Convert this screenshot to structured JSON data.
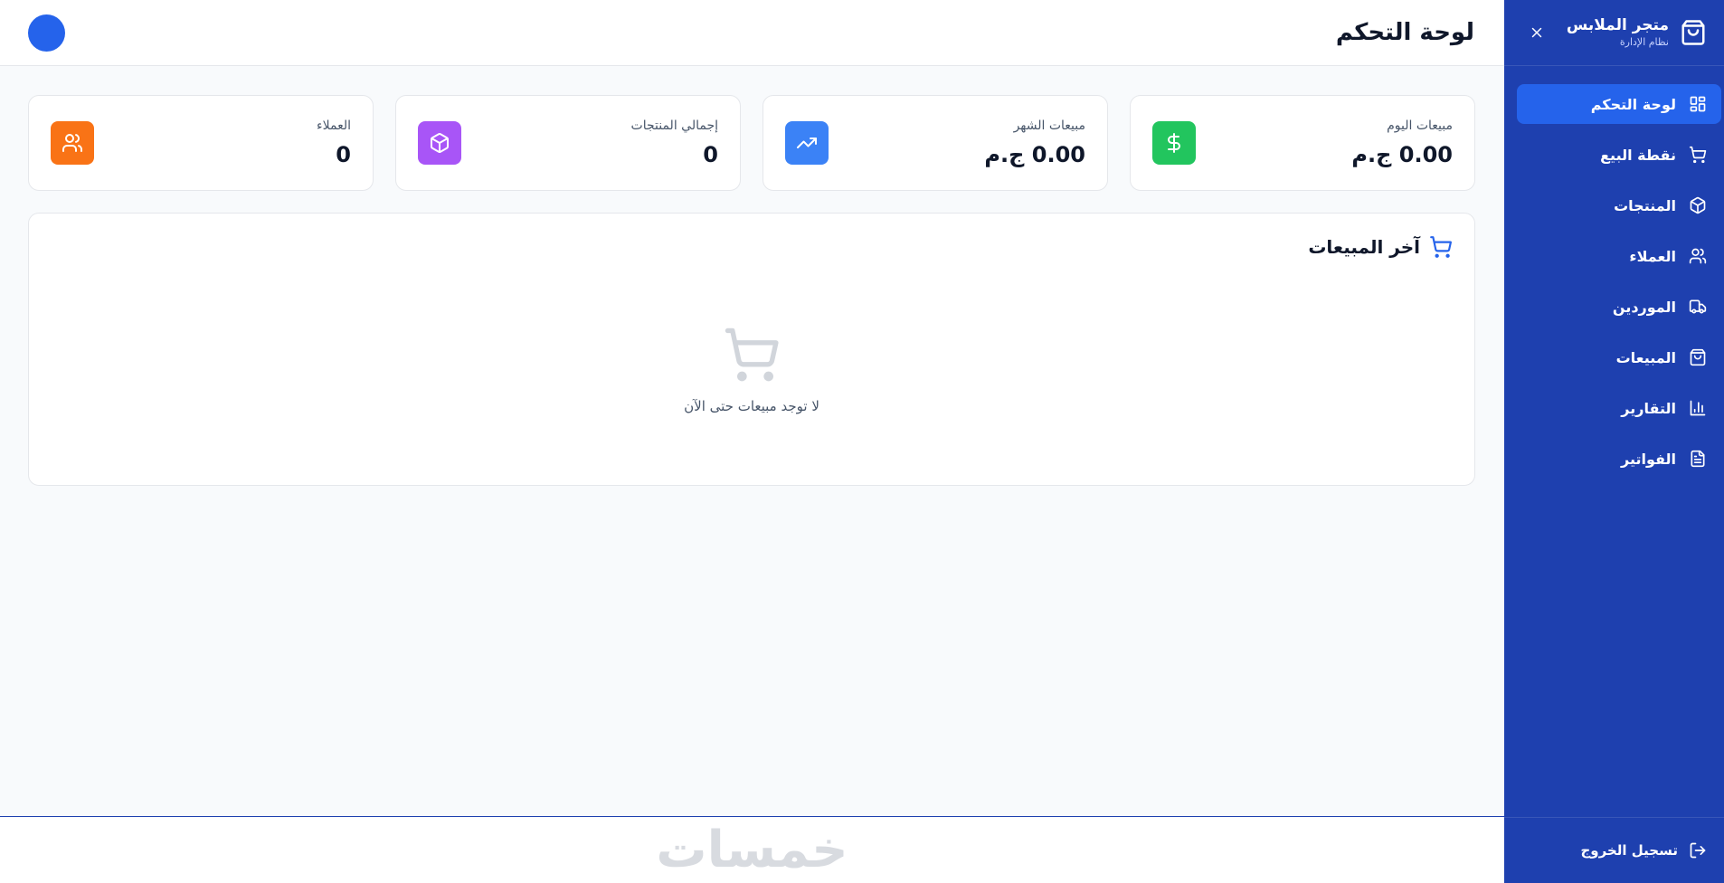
{
  "sidebar": {
    "brand_title": "متجر الملابس",
    "brand_subtitle": "نظام الإدارة",
    "items": [
      {
        "label": "لوحة التحكم",
        "icon": "dashboard-icon",
        "active": true
      },
      {
        "label": "نقطة البيع",
        "icon": "cart-icon"
      },
      {
        "label": "المنتجات",
        "icon": "box-icon"
      },
      {
        "label": "العملاء",
        "icon": "users-icon"
      },
      {
        "label": "الموردين",
        "icon": "truck-icon"
      },
      {
        "label": "المبيعات",
        "icon": "shopping-bag-icon"
      },
      {
        "label": "التقارير",
        "icon": "bar-chart-icon"
      },
      {
        "label": "الفواتير",
        "icon": "file-text-icon"
      }
    ],
    "logout_label": "تسجيل الخروج"
  },
  "header": {
    "title": "لوحة التحكم"
  },
  "stats": [
    {
      "label": "مبيعات اليوم",
      "value": "0.00 ج.م",
      "icon": "dollar-icon",
      "color": "#22c55e"
    },
    {
      "label": "مبيعات الشهر",
      "value": "0.00 ج.م",
      "icon": "trending-up-icon",
      "color": "#3b82f6"
    },
    {
      "label": "إجمالي المنتجات",
      "value": "0",
      "icon": "box-icon",
      "color": "#a855f7"
    },
    {
      "label": "العملاء",
      "value": "0",
      "icon": "users-icon",
      "color": "#f97316"
    }
  ],
  "recent_sales": {
    "title": "آخر المبيعات",
    "empty_text": "لا توجد مبيعات حتى الآن"
  },
  "watermark": "خمسات",
  "colors": {
    "sidebar": "#1e40af",
    "accent": "#2563eb"
  }
}
